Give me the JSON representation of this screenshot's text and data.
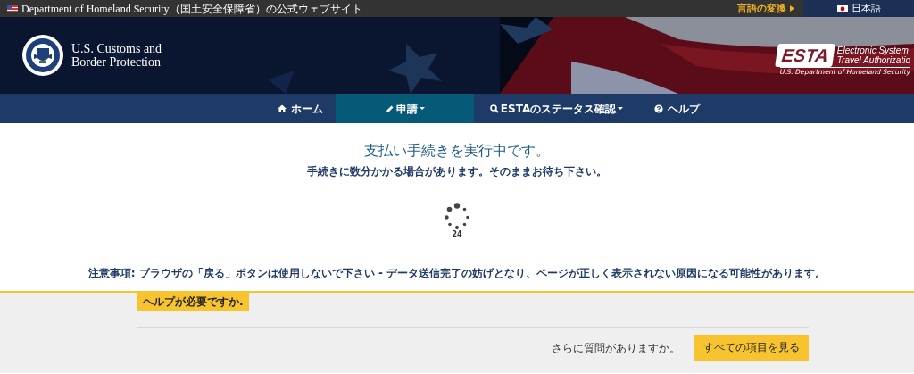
{
  "top_bar": {
    "site_notice": "Department of Homeland Security（国土安全保障省）の公式ウェブサイト",
    "language_switch": "言語の変換",
    "language_switch_expanded": false,
    "language": "日本語"
  },
  "header": {
    "agency_name": [
      "U.S. Customs and",
      "Border Protection"
    ],
    "esta_logo": {
      "mark": "ESTA",
      "lines": [
        "Electronic System",
        "Travel Authorizatio"
      ],
      "tagline": "U.S. Department of Homeland Security"
    }
  },
  "nav": [
    {
      "label": "ホーム",
      "kind": "home",
      "dropdown": false,
      "selected": false
    },
    {
      "label": "申請",
      "kind": "edit",
      "dropdown": true,
      "selected": true
    },
    {
      "label": "ESTAのステータス確認",
      "kind": "search",
      "dropdown": true,
      "selected": false
    },
    {
      "label": "ヘルプ",
      "kind": "help",
      "dropdown": false,
      "selected": false
    }
  ],
  "main": {
    "title": "支払い手続きを実行中です。",
    "subtitle": "手続きに数分かかる場合があります。そのままお待ち下さい。",
    "counter": "24",
    "notice": "注意事項: ブラウザの「戻る」ボタンは使用しないで下さい - データ送信完了の妨げとなり、ページが正しく表示されない原因になる可能性があります。"
  },
  "help": {
    "badge": "ヘルプが必要ですか.",
    "question": "さらに質問がありますか。",
    "button": "すべての項目を見る"
  }
}
